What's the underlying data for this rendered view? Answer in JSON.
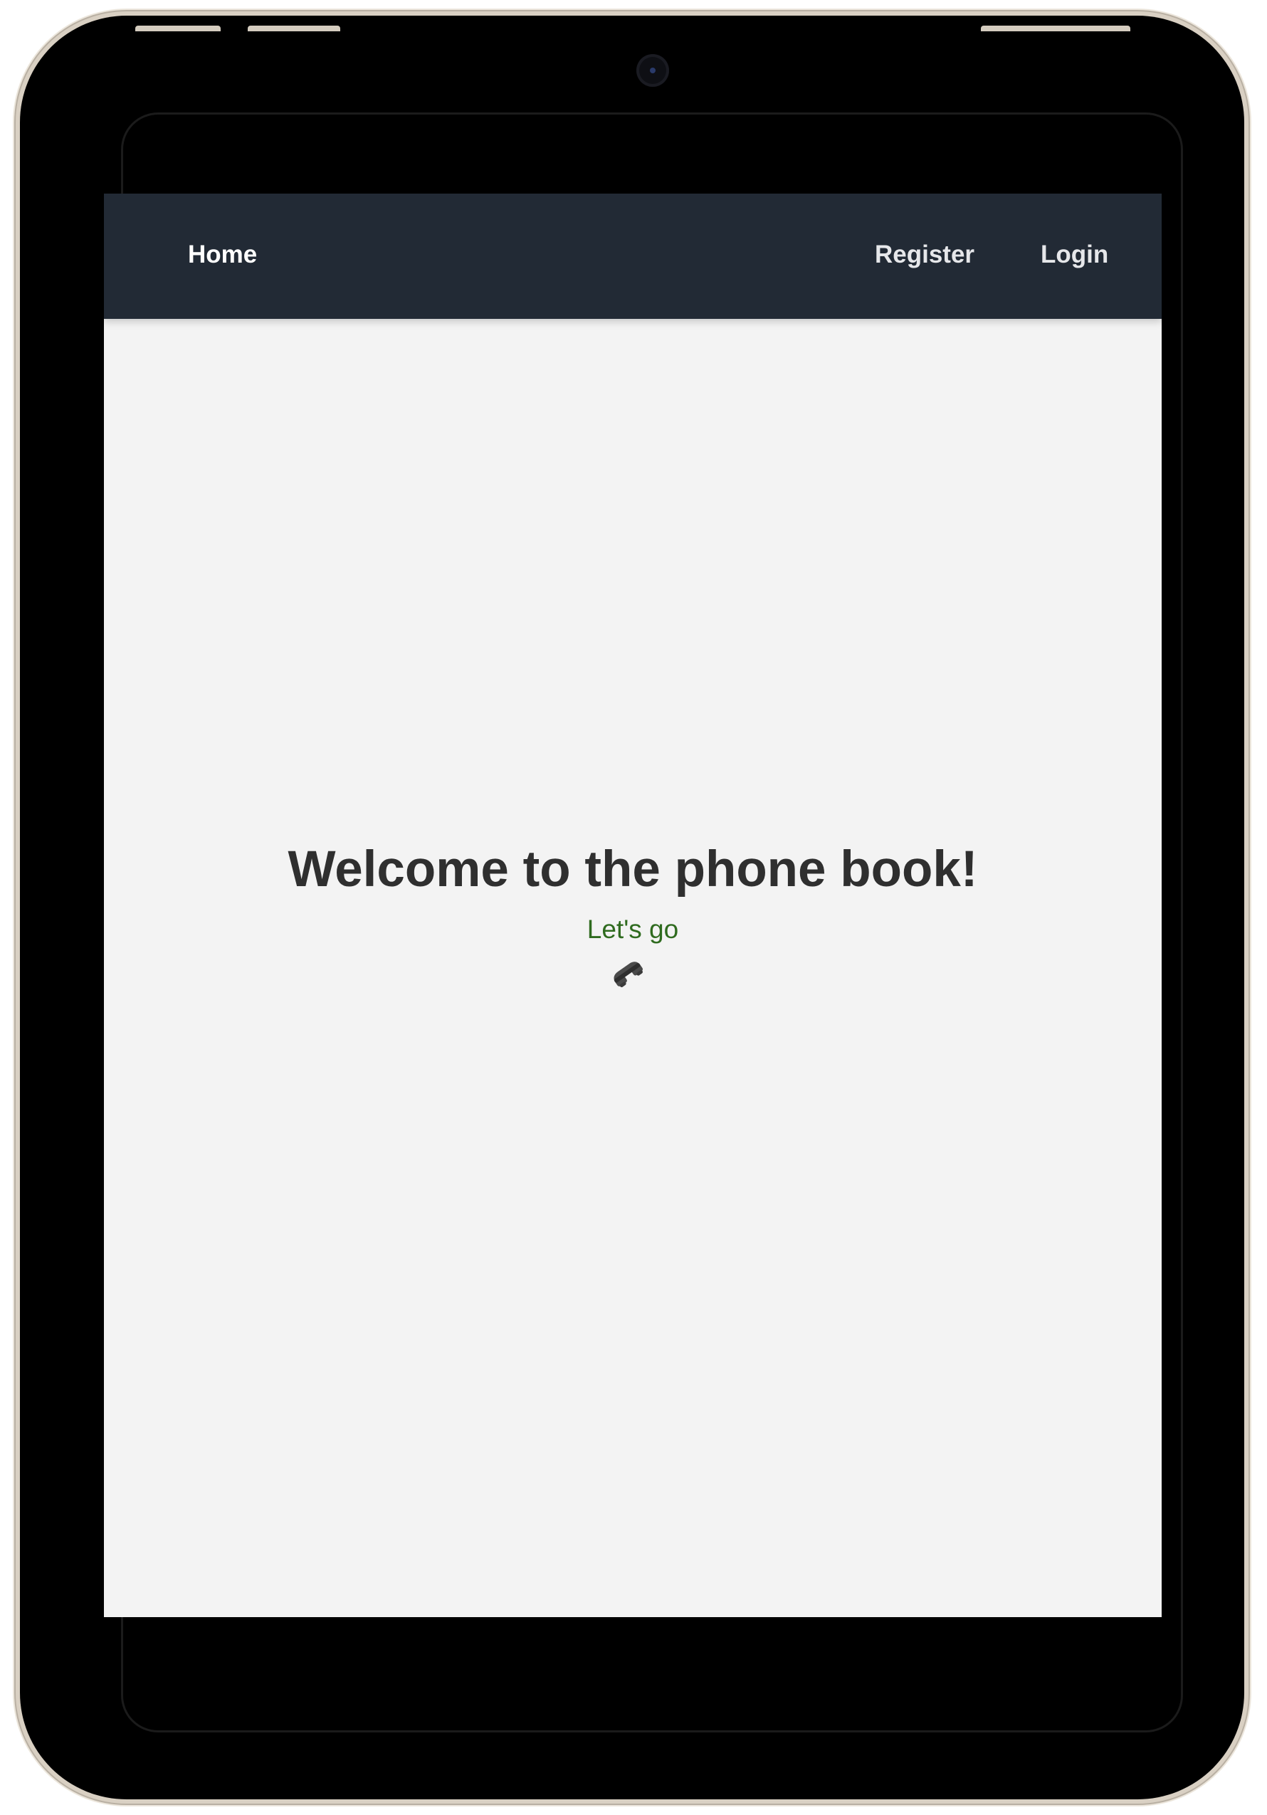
{
  "navbar": {
    "home_label": "Home",
    "register_label": "Register",
    "login_label": "Login"
  },
  "hero": {
    "title": "Welcome to the phone book!",
    "subtitle": "Let's go",
    "icon": "telephone-receiver-icon"
  },
  "colors": {
    "navbar_bg": "#222a35",
    "page_bg": "#f3f3f3",
    "title_text": "#2f2f2f",
    "subtitle_text": "#2f6b1f"
  }
}
